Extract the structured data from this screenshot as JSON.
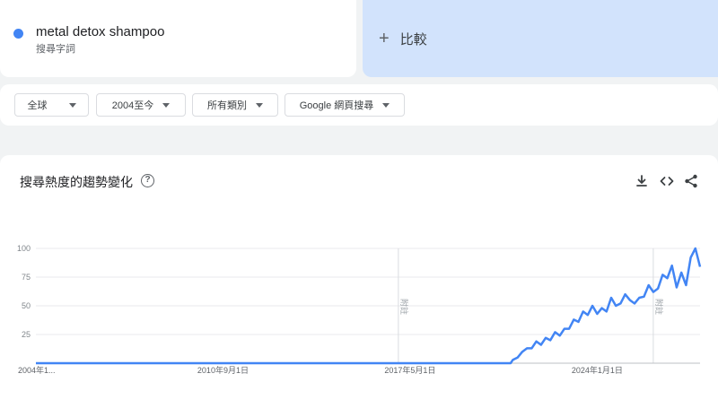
{
  "search_term": {
    "name": "metal detox shampoo",
    "type_label": "搜尋字詞",
    "color": "#4285f4"
  },
  "compare": {
    "icon": "plus-icon",
    "label": "比較"
  },
  "filters": [
    {
      "label": "全球"
    },
    {
      "label": "2004至今"
    },
    {
      "label": "所有類別"
    },
    {
      "label": "Google 網頁搜尋"
    }
  ],
  "chart_panel": {
    "title": "搜尋熱度的趨勢變化",
    "actions": [
      "download-icon",
      "embed-code-icon",
      "share-icon"
    ]
  },
  "chart_data": {
    "type": "line",
    "title": "",
    "xlabel": "",
    "ylabel": "",
    "ylim": [
      0,
      100
    ],
    "y_ticks": [
      "100",
      "75",
      "50",
      "25"
    ],
    "x_tick_labels": [
      "2004年1...",
      "2010年9月1日",
      "2017年5月1日",
      "2024年1月1日"
    ],
    "annotations": [
      "附註",
      "附註"
    ],
    "grid": true,
    "series": [
      {
        "color": "#4285f4",
        "points": [
          [
            "2004-01",
            0
          ],
          [
            "2010-09",
            0
          ],
          [
            "2017-05",
            0
          ],
          [
            "2020-12",
            0
          ],
          [
            "2021-01",
            3
          ],
          [
            "2021-03",
            5
          ],
          [
            "2021-05",
            10
          ],
          [
            "2021-07",
            13
          ],
          [
            "2021-09",
            13
          ],
          [
            "2021-11",
            19
          ],
          [
            "2022-01",
            16
          ],
          [
            "2022-03",
            22
          ],
          [
            "2022-05",
            20
          ],
          [
            "2022-07",
            27
          ],
          [
            "2022-09",
            24
          ],
          [
            "2022-11",
            30
          ],
          [
            "2023-01",
            30
          ],
          [
            "2023-03",
            38
          ],
          [
            "2023-05",
            36
          ],
          [
            "2023-07",
            45
          ],
          [
            "2023-09",
            42
          ],
          [
            "2023-11",
            50
          ],
          [
            "2024-01",
            43
          ],
          [
            "2024-03",
            48
          ],
          [
            "2024-05",
            45
          ],
          [
            "2024-07",
            57
          ],
          [
            "2024-09",
            50
          ],
          [
            "2024-11",
            52
          ],
          [
            "2025-01",
            60
          ],
          [
            "2025-03",
            55
          ],
          [
            "2025-05",
            52
          ],
          [
            "2025-07",
            57
          ],
          [
            "2025-09",
            58
          ],
          [
            "2025-11",
            68
          ],
          [
            "2026-01",
            62
          ],
          [
            "2026-03",
            65
          ],
          [
            "2026-05",
            77
          ],
          [
            "2026-07",
            74
          ],
          [
            "2026-09",
            85
          ],
          [
            "2026-11",
            66
          ],
          [
            "2027-01",
            79
          ],
          [
            "2027-03",
            68
          ],
          [
            "2027-05",
            92
          ],
          [
            "2027-07",
            100
          ],
          [
            "2027-09",
            84
          ]
        ]
      }
    ]
  }
}
